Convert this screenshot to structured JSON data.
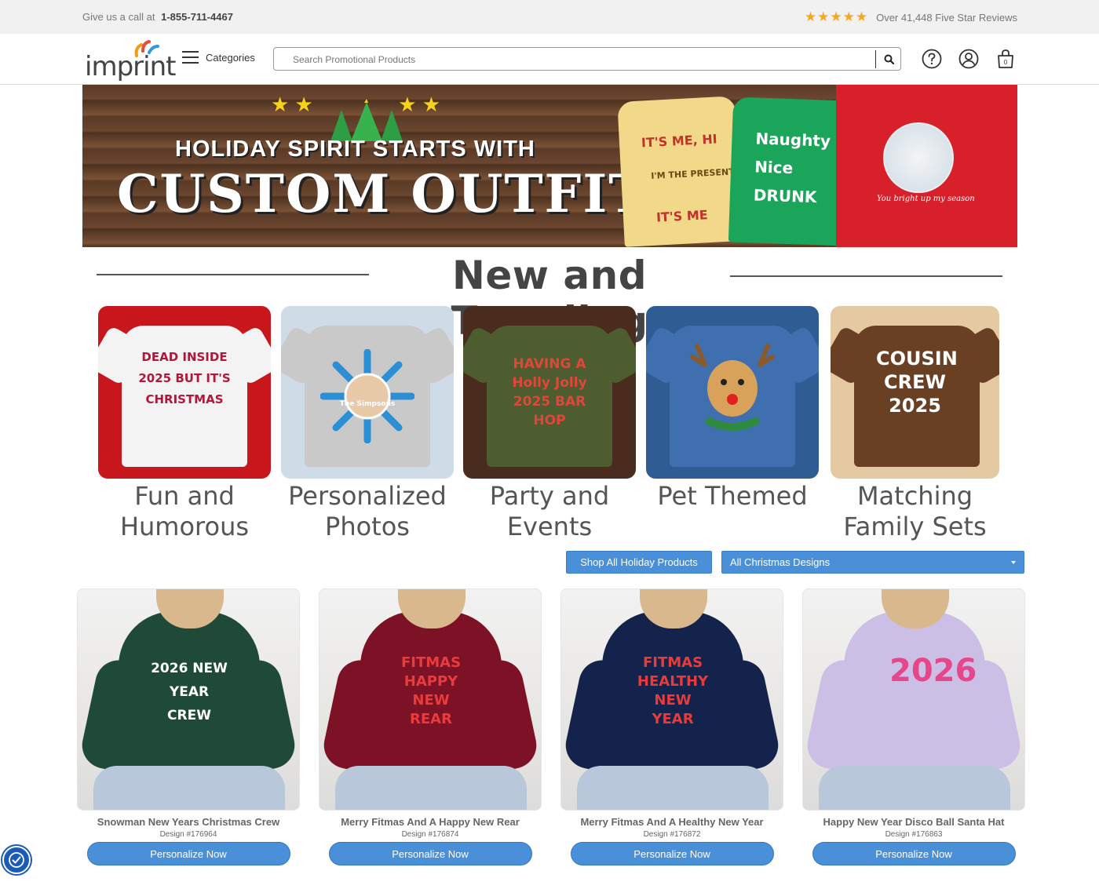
{
  "topbar": {
    "call_text": "Give us a call at",
    "phone": "1-855-711-4467",
    "stars": "★★★★★",
    "reviews_text": "Over 41,448 Five Star Reviews"
  },
  "header": {
    "logo_text": "imprint",
    "categories_label": "Categories",
    "search_placeholder": "Search Promotional Products",
    "icons": [
      "help-icon",
      "account-icon",
      "cart-icon"
    ],
    "cart_count": "0"
  },
  "banner": {
    "line1": "HOLIDAY SPIRIT STARTS WITH",
    "line2": "CUSTOM OUTFITS",
    "shirt_yellow": [
      "IT'S ME, HI",
      "I'M THE PRESENT",
      "IT'S ME"
    ],
    "shirt_green": [
      "Naughty",
      "Nice",
      "DRUNK"
    ],
    "shirt_red_caption": "You bright up my season"
  },
  "section": {
    "title": "New and Trending"
  },
  "categories": [
    {
      "label": "Fun and Humorous",
      "art": "DEAD INSIDE 2025 BUT IT'S CHRISTMAS",
      "bg": "#c8161d",
      "tee": "#f3f3f3",
      "ink": "#b0173a"
    },
    {
      "label": "Personalized Photos",
      "art": "The Simpsons",
      "bg": "#cfdbe6",
      "tee": "#c9c9c9",
      "ink": "#2b8fd6"
    },
    {
      "label": "Party and Events",
      "art": "HAVING A Holly Jolly 2025 BAR HOP",
      "bg": "#4a2c1e",
      "tee": "#4e5d2f",
      "ink": "#e0463a"
    },
    {
      "label": "Pet Themed",
      "art": "",
      "bg": "#2f5c93",
      "tee": "#3f6fae",
      "ink": "#f2f2f2"
    },
    {
      "label": "Matching Family Sets",
      "art": "COUSIN CREW 2025",
      "bg": "#e5c9a3",
      "tee": "#6a4024",
      "ink": "#ffffff"
    }
  ],
  "filters": {
    "shop_all": "Shop All Holiday Products",
    "select_value": "All Christmas Designs"
  },
  "products": [
    {
      "name": "Snowman New Years Christmas Crew",
      "design": "Design #176964",
      "button": "Personalize Now",
      "hood": "#1e4a37",
      "print": "2026 NEW YEAR CREW",
      "ink": "#ffffff"
    },
    {
      "name": "Merry Fitmas And A Happy New Rear",
      "design": "Design #176874",
      "button": "Personalize Now",
      "hood": "#7d1226",
      "print": "FITMAS HAPPY NEW REAR",
      "ink": "#ea3b3b"
    },
    {
      "name": "Merry Fitmas And A Healthy New Year",
      "design": "Design #176872",
      "button": "Personalize Now",
      "hood": "#13234b",
      "print": "FITMAS HEALTHY NEW YEAR",
      "ink": "#ea3b3b"
    },
    {
      "name": "Happy New Year Disco Ball Santa Hat",
      "design": "Design #176863",
      "button": "Personalize Now",
      "hood": "#cbbfe6",
      "print": "2026",
      "ink": "#e8468a"
    }
  ]
}
